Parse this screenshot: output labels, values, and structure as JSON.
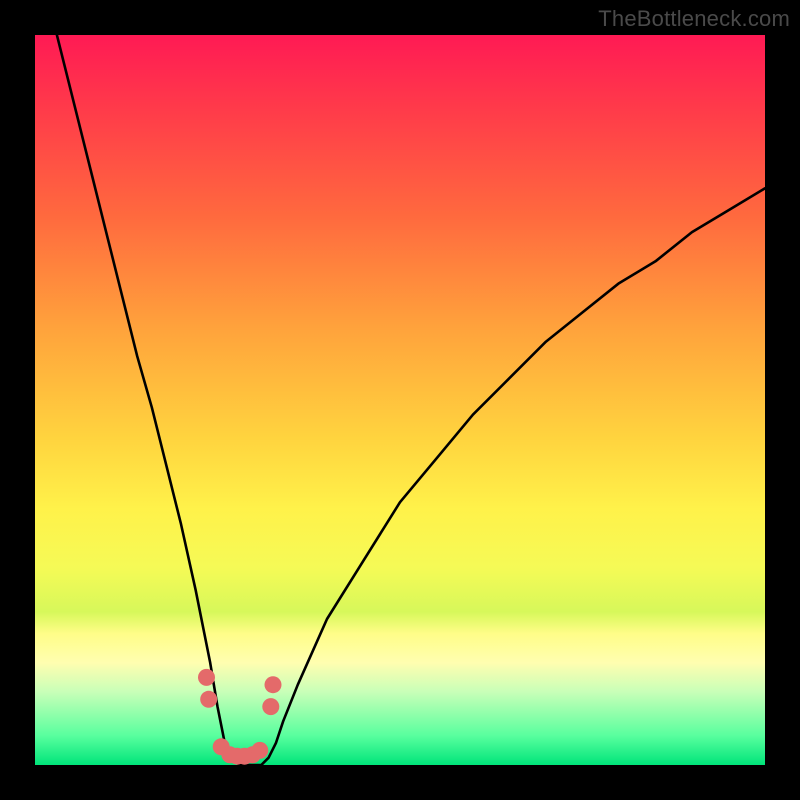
{
  "watermark": "TheBottleneck.com",
  "chart_data": {
    "type": "line",
    "title": "",
    "xlabel": "",
    "ylabel": "",
    "ylim": [
      0,
      100
    ],
    "series": [
      {
        "name": "curve",
        "x": [
          0,
          2,
          4,
          6,
          8,
          10,
          12,
          14,
          16,
          18,
          20,
          22,
          24,
          25,
          26,
          27,
          28,
          29,
          30,
          31,
          32,
          33,
          34,
          36,
          40,
          45,
          50,
          55,
          60,
          65,
          70,
          75,
          80,
          85,
          90,
          95,
          100
        ],
        "values": [
          112,
          104,
          96,
          88,
          80,
          72,
          64,
          56,
          49,
          41,
          33,
          24,
          14,
          8,
          3,
          1,
          0,
          0,
          0,
          0,
          1,
          3,
          6,
          11,
          20,
          28,
          36,
          42,
          48,
          53,
          58,
          62,
          66,
          69,
          73,
          76,
          79
        ]
      },
      {
        "name": "dots",
        "x": [
          23.5,
          23.8,
          25.5,
          26.7,
          27.7,
          28.7,
          29.8,
          30.8,
          32.3,
          32.6
        ],
        "values": [
          12,
          9,
          2.5,
          1.4,
          1.2,
          1.2,
          1.4,
          2.0,
          8,
          11
        ]
      }
    ],
    "marker_color": "#e46a6a",
    "line_color": "#000000"
  }
}
